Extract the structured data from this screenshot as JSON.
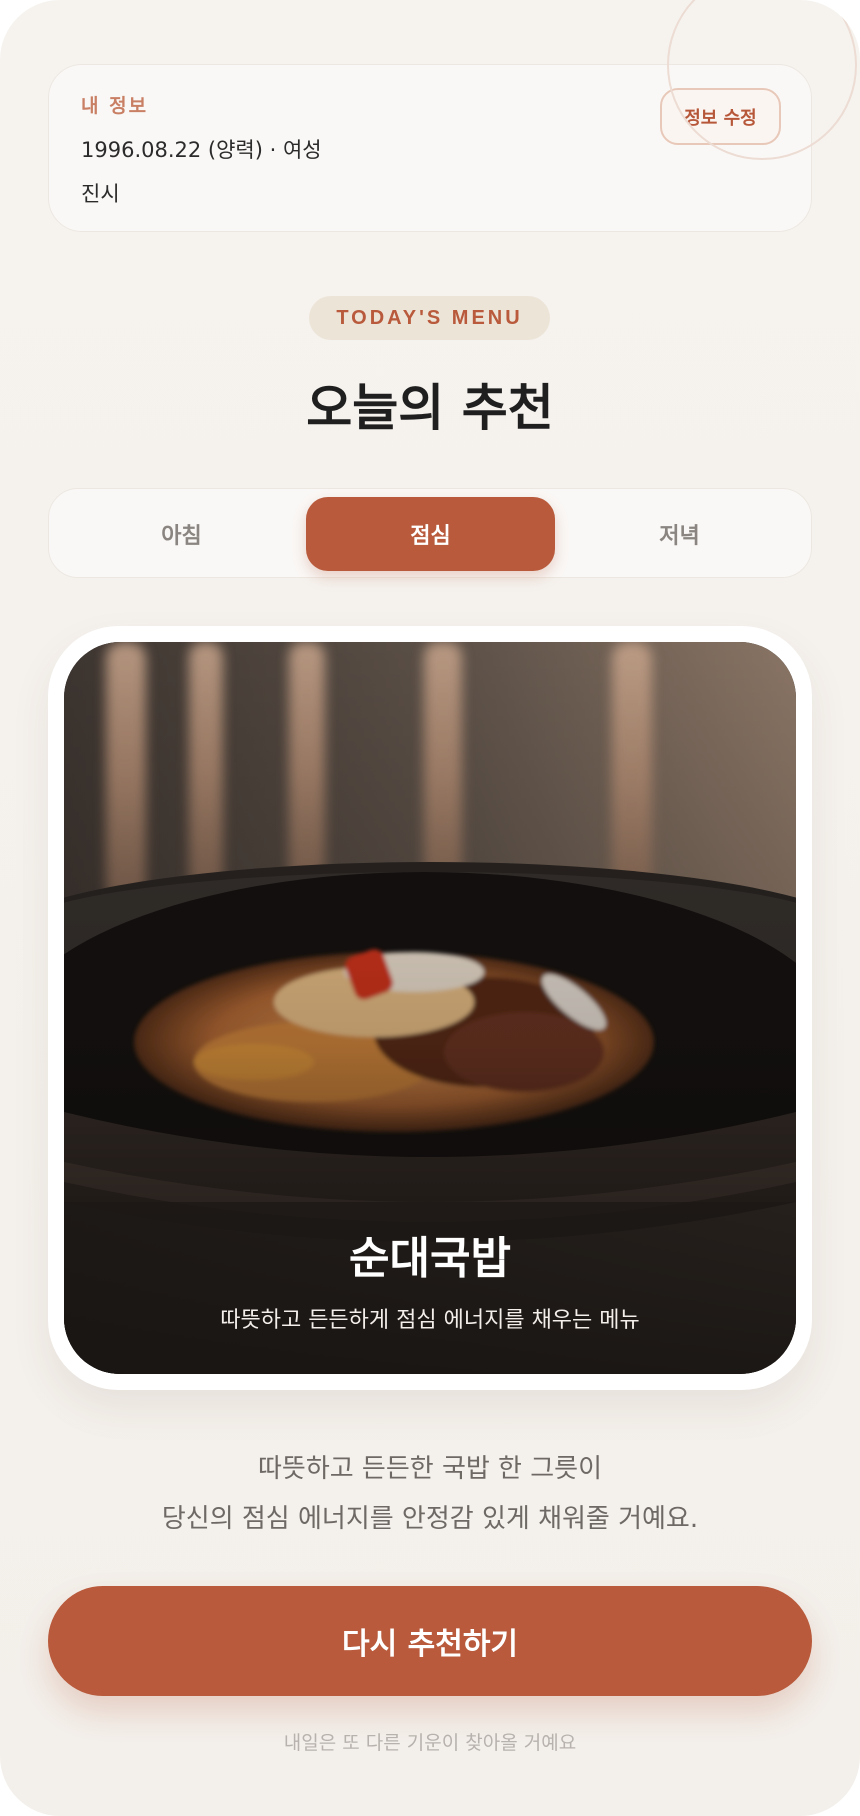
{
  "profile": {
    "label": "내 정보",
    "birth": "1996.08.22 (양력) · 여성",
    "time": "진시",
    "edit_label": "정보 수정"
  },
  "header": {
    "badge": "TODAY'S MENU",
    "title": "오늘의 추천"
  },
  "tabs": [
    {
      "label": "아침",
      "active": false
    },
    {
      "label": "점심",
      "active": true
    },
    {
      "label": "저녁",
      "active": false
    }
  ],
  "recommendation": {
    "name": "순대국밥",
    "subtitle": "따뜻하고 든든하게 점심 에너지를 채우는 메뉴",
    "image": "bibimbap-bowl-photo"
  },
  "description": {
    "line1": "따뜻하고 든든한 국밥 한 그릇이",
    "line2": "당신의 점심 에너지를 안정감 있게 채워줄 거예요."
  },
  "cta_label": "다시 추천하기",
  "footnote": "내일은 또 다른 기운이 찾아올 거예요",
  "colors": {
    "accent": "#b85a3b",
    "background": "#f5f2ee",
    "text": "#1f1f1f"
  }
}
